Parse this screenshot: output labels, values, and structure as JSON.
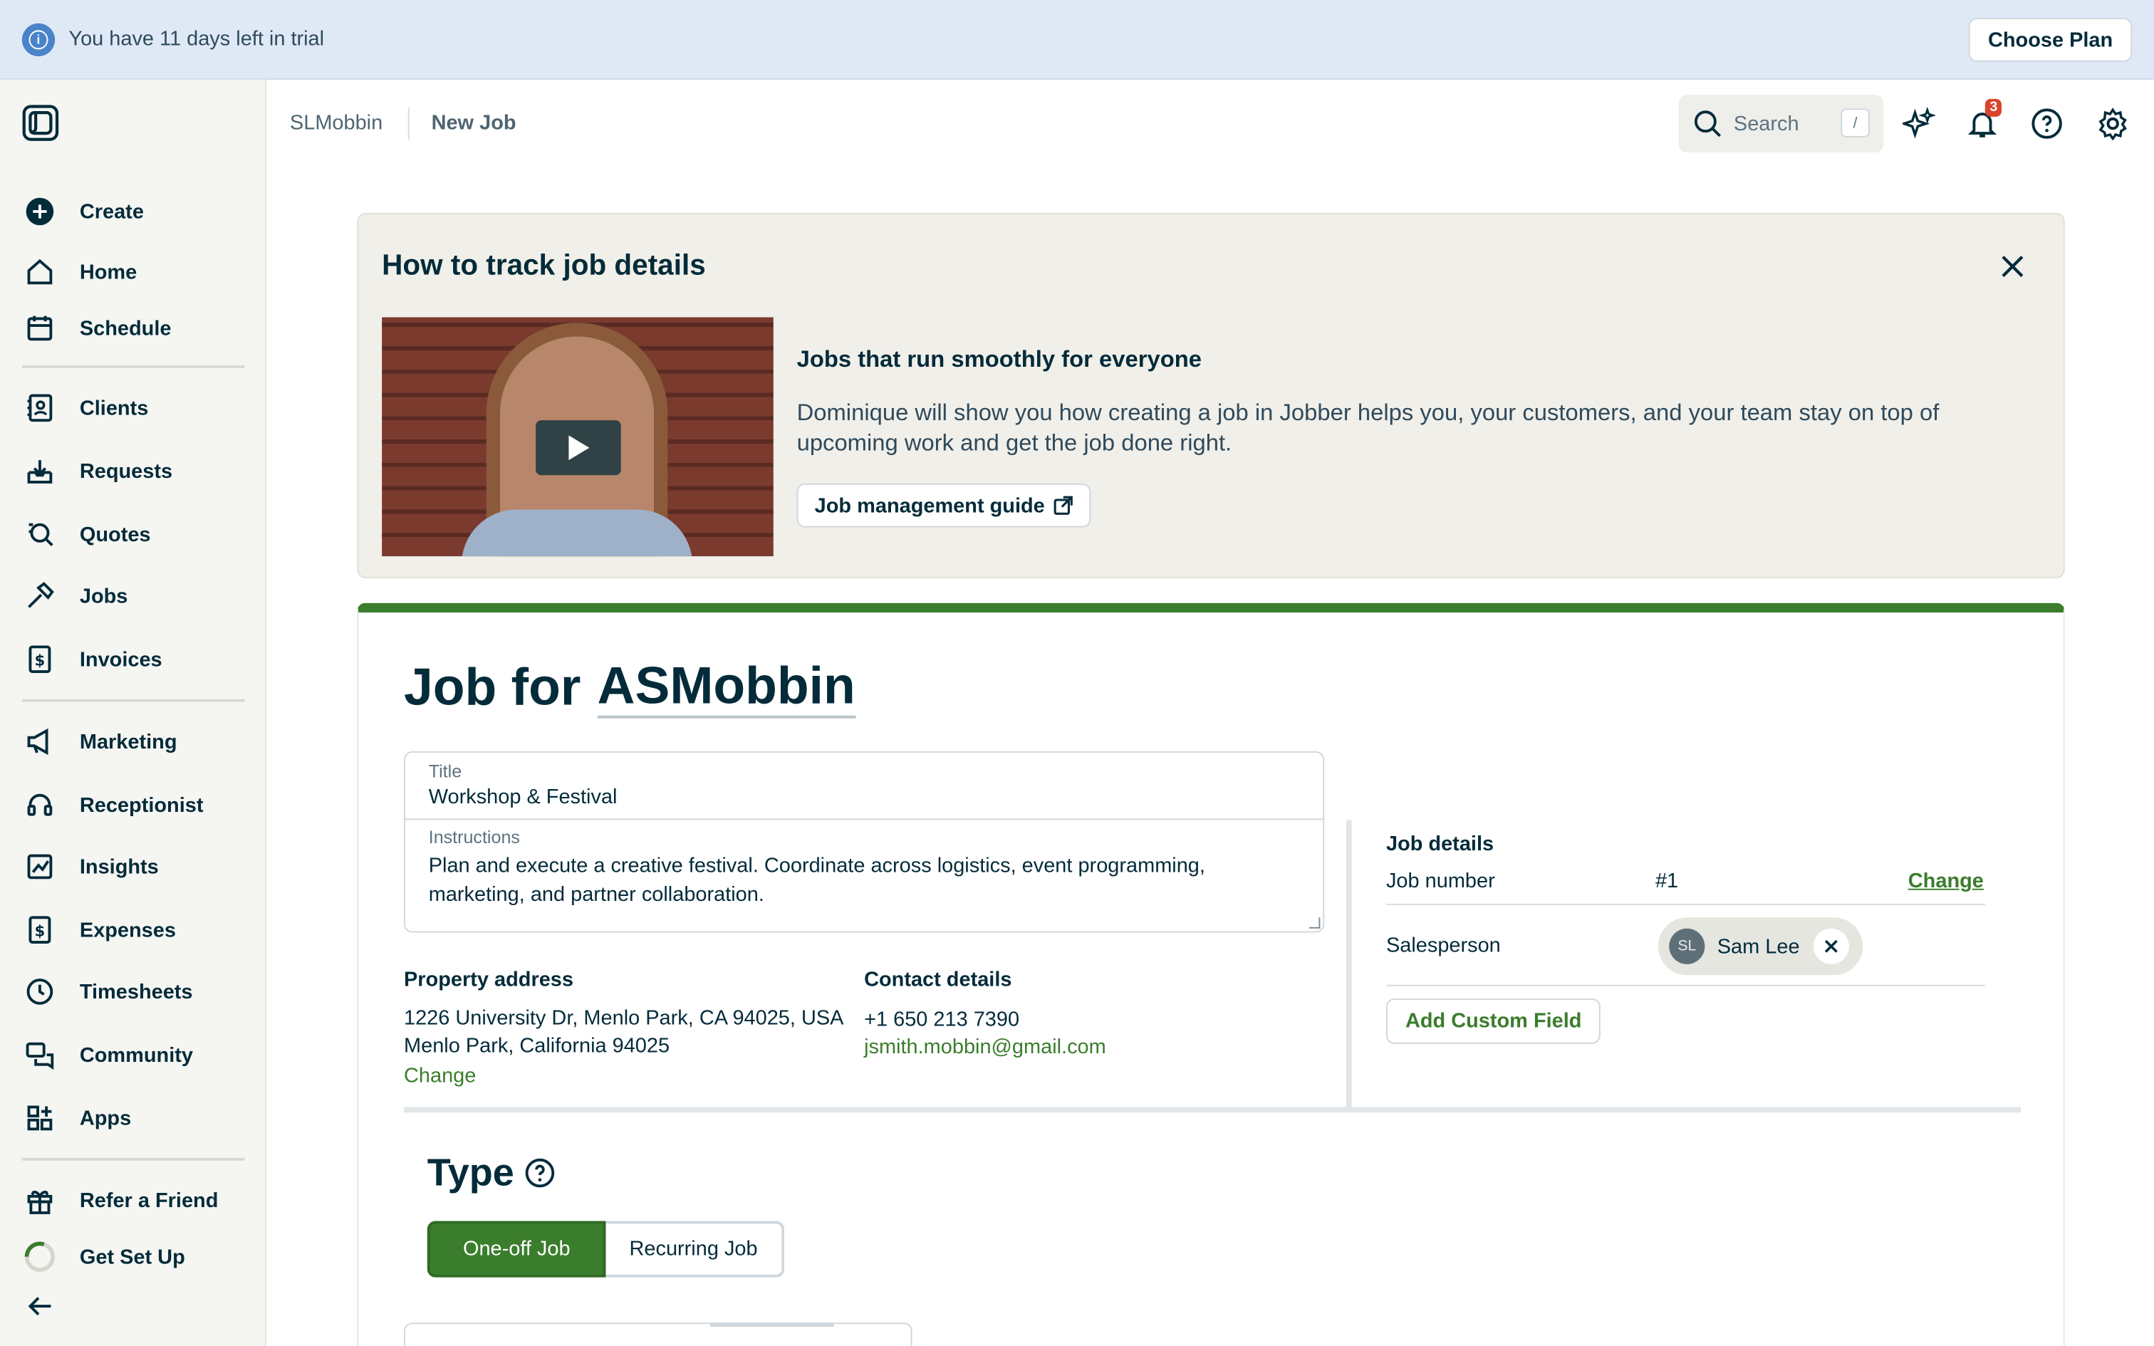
{
  "trial": {
    "message": "You have 11 days left in trial",
    "button": "Choose Plan"
  },
  "sidebar": {
    "items": [
      {
        "label": "Create",
        "icon": "plus-circle-icon"
      },
      {
        "label": "Home",
        "icon": "home-icon"
      },
      {
        "label": "Schedule",
        "icon": "calendar-icon"
      },
      {
        "label": "Clients",
        "icon": "contact-card-icon"
      },
      {
        "label": "Requests",
        "icon": "inbox-download-icon"
      },
      {
        "label": "Quotes",
        "icon": "quote-search-icon"
      },
      {
        "label": "Jobs",
        "icon": "hammer-icon"
      },
      {
        "label": "Invoices",
        "icon": "invoice-dollar-icon"
      },
      {
        "label": "Marketing",
        "icon": "megaphone-icon"
      },
      {
        "label": "Receptionist",
        "icon": "headset-icon"
      },
      {
        "label": "Insights",
        "icon": "chart-line-icon"
      },
      {
        "label": "Expenses",
        "icon": "receipt-dollar-icon"
      },
      {
        "label": "Timesheets",
        "icon": "clock-icon"
      },
      {
        "label": "Community",
        "icon": "chat-bubbles-icon"
      },
      {
        "label": "Apps",
        "icon": "apps-grid-icon"
      },
      {
        "label": "Refer a Friend",
        "icon": "gift-icon"
      },
      {
        "label": "Get Set Up",
        "icon": "progress-ring-icon"
      }
    ]
  },
  "breadcrumb": {
    "account": "SLMobbin",
    "page": "New Job"
  },
  "search": {
    "placeholder": "Search",
    "shortcut": "/"
  },
  "notifications": {
    "count": "3"
  },
  "help_card": {
    "title": "How to track job details",
    "subtitle": "Jobs that run smoothly for everyone",
    "description": "Dominique will show you how creating a job in Jobber helps you, your customers, and your team stay on top of upcoming work and get the job done right.",
    "guide_button": "Job management guide"
  },
  "job": {
    "heading_prefix": "Job for",
    "client": "ASMobbin",
    "title_label": "Title",
    "title_value": "Workshop & Festival",
    "instructions_label": "Instructions",
    "instructions_value": "Plan and execute a creative festival. Coordinate across logistics, event programming, marketing, and partner collaboration.",
    "property_label": "Property address",
    "property_line1": "1226 University Dr, Menlo Park, CA 94025, USA",
    "property_line2": "Menlo Park, California 94025",
    "property_change": "Change",
    "contact_label": "Contact details",
    "contact_phone": "+1 650 213 7390",
    "contact_email": "jsmith.mobbin@gmail.com"
  },
  "job_details": {
    "title": "Job details",
    "job_number_label": "Job number",
    "job_number": "#1",
    "change": "Change",
    "salesperson_label": "Salesperson",
    "salesperson_initials": "SL",
    "salesperson_name": "Sam Lee",
    "add_custom_field": "Add Custom Field"
  },
  "type": {
    "title": "Type",
    "one_off": "One-off Job",
    "recurring": "Recurring Job",
    "selected": "One-off Job"
  },
  "colors": {
    "accent": "#3a7d2c",
    "text": "#032b3a",
    "trial_bg": "#dfe9f6"
  }
}
